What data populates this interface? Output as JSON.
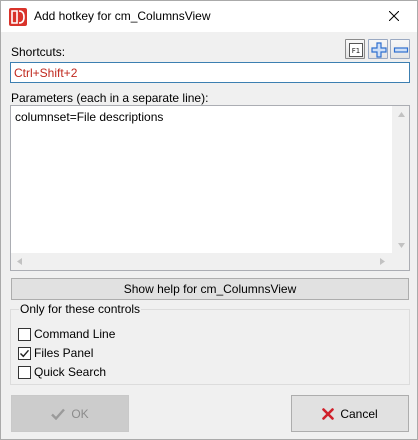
{
  "window": {
    "title": "Add hotkey for cm_ColumnsView"
  },
  "shortcuts": {
    "label": "Shortcuts:",
    "value": "Ctrl+Shift+2",
    "f1_label": "F1"
  },
  "parameters": {
    "label": "Parameters (each in a separate line):",
    "text": "columnset=File descriptions"
  },
  "help_button": {
    "label": "Show help for cm_ColumnsView"
  },
  "controls_group": {
    "title": "Only for these controls",
    "items": [
      {
        "label": "Command Line",
        "checked": false
      },
      {
        "label": "Files Panel",
        "checked": true
      },
      {
        "label": "Quick Search",
        "checked": false
      }
    ]
  },
  "buttons": {
    "ok_label": "OK",
    "ok_enabled": false,
    "cancel_label": "Cancel"
  },
  "colors": {
    "shortcut_text": "#c0281d",
    "add_icon": "#2f6fcf",
    "cancel_icon": "#d0202a",
    "app_icon": "#d9332a"
  },
  "icons": {
    "app": "double-commander-icon",
    "close": "close-icon",
    "help_f1": "f1-help-icon",
    "add": "plus-icon",
    "remove": "minus-icon",
    "ok": "checkmark-icon",
    "cancel": "red-x-icon"
  }
}
